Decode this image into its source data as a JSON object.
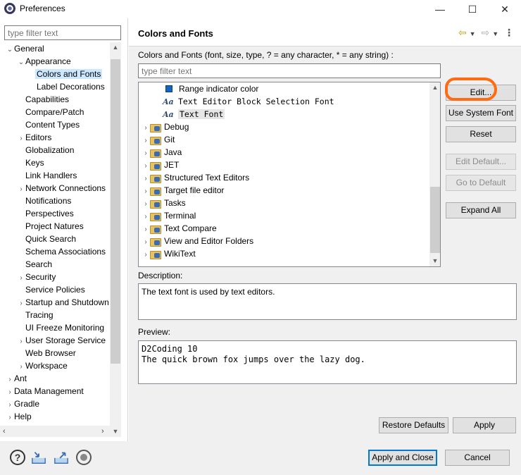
{
  "window": {
    "title": "Preferences",
    "controls": [
      "—",
      "☐",
      "✕"
    ]
  },
  "left": {
    "filter_placeholder": "type filter text",
    "tree": [
      {
        "label": "General",
        "level": 0,
        "twisty": "down"
      },
      {
        "label": "Appearance",
        "level": 1,
        "twisty": "down"
      },
      {
        "label": "Colors and Fonts",
        "level": 2,
        "twisty": "",
        "selected": true
      },
      {
        "label": "Label Decorations",
        "level": 2,
        "twisty": ""
      },
      {
        "label": "Capabilities",
        "level": 1,
        "twisty": ""
      },
      {
        "label": "Compare/Patch",
        "level": 1,
        "twisty": ""
      },
      {
        "label": "Content Types",
        "level": 1,
        "twisty": ""
      },
      {
        "label": "Editors",
        "level": 1,
        "twisty": "right"
      },
      {
        "label": "Globalization",
        "level": 1,
        "twisty": ""
      },
      {
        "label": "Keys",
        "level": 1,
        "twisty": ""
      },
      {
        "label": "Link Handlers",
        "level": 1,
        "twisty": ""
      },
      {
        "label": "Network Connections",
        "level": 1,
        "twisty": "right"
      },
      {
        "label": "Notifications",
        "level": 1,
        "twisty": ""
      },
      {
        "label": "Perspectives",
        "level": 1,
        "twisty": ""
      },
      {
        "label": "Project Natures",
        "level": 1,
        "twisty": ""
      },
      {
        "label": "Quick Search",
        "level": 1,
        "twisty": ""
      },
      {
        "label": "Schema Associations",
        "level": 1,
        "twisty": ""
      },
      {
        "label": "Search",
        "level": 1,
        "twisty": ""
      },
      {
        "label": "Security",
        "level": 1,
        "twisty": "right"
      },
      {
        "label": "Service Policies",
        "level": 1,
        "twisty": ""
      },
      {
        "label": "Startup and Shutdown",
        "level": 1,
        "twisty": "right"
      },
      {
        "label": "Tracing",
        "level": 1,
        "twisty": ""
      },
      {
        "label": "UI Freeze Monitoring",
        "level": 1,
        "twisty": ""
      },
      {
        "label": "User Storage Service",
        "level": 1,
        "twisty": "right"
      },
      {
        "label": "Web Browser",
        "level": 1,
        "twisty": ""
      },
      {
        "label": "Workspace",
        "level": 1,
        "twisty": "right"
      },
      {
        "label": "Ant",
        "level": 0,
        "twisty": "right"
      },
      {
        "label": "Data Management",
        "level": 0,
        "twisty": "right"
      },
      {
        "label": "Gradle",
        "level": 0,
        "twisty": "right"
      },
      {
        "label": "Help",
        "level": 0,
        "twisty": "right"
      }
    ]
  },
  "header": {
    "title": "Colors and Fonts"
  },
  "content": {
    "description_line": "Colors and Fonts (font, size, type, ? = any character, * = any string) :",
    "filter_placeholder": "type filter text",
    "font_tree": [
      {
        "label": "Range indicator color",
        "icon": "color-square-icon",
        "indent": 2,
        "mono": false
      },
      {
        "label": "Text Editor Block Selection Font",
        "icon": "font-icon",
        "indent": 2,
        "mono": true
      },
      {
        "label": "Text Font",
        "icon": "font-icon",
        "indent": 2,
        "mono": true,
        "selected": true
      },
      {
        "label": "Debug",
        "icon": "folder-icon",
        "indent": 1
      },
      {
        "label": "Git",
        "icon": "folder-icon",
        "indent": 1
      },
      {
        "label": "Java",
        "icon": "folder-icon",
        "indent": 1
      },
      {
        "label": "JET",
        "icon": "folder-icon",
        "indent": 1
      },
      {
        "label": "Structured Text Editors",
        "icon": "folder-icon",
        "indent": 1
      },
      {
        "label": "Target file editor",
        "icon": "folder-icon",
        "indent": 1
      },
      {
        "label": "Tasks",
        "icon": "folder-icon",
        "indent": 1
      },
      {
        "label": "Terminal",
        "icon": "folder-icon",
        "indent": 1
      },
      {
        "label": "Text Compare",
        "icon": "folder-icon",
        "indent": 1
      },
      {
        "label": "View and Editor Folders",
        "icon": "folder-icon",
        "indent": 1
      },
      {
        "label": "WikiText",
        "icon": "folder-icon",
        "indent": 1
      }
    ],
    "buttons": {
      "edit": "Edit...",
      "use_system_font": "Use System Font",
      "reset": "Reset",
      "edit_default": "Edit Default...",
      "go_to_default": "Go to Default",
      "expand_all": "Expand All"
    },
    "description_label": "Description:",
    "description_text": "The text font is used by text editors.",
    "preview_label": "Preview:",
    "preview_line1": "D2Coding 10",
    "preview_line2": "The quick brown fox jumps over the lazy dog.",
    "restore_defaults": "Restore Defaults",
    "apply": "Apply"
  },
  "footer": {
    "apply_and_close": "Apply and Close",
    "cancel": "Cancel"
  },
  "colors": {
    "accent": "#0078d7",
    "selection": "#cce8ff",
    "annotation": "#ff6a13"
  }
}
